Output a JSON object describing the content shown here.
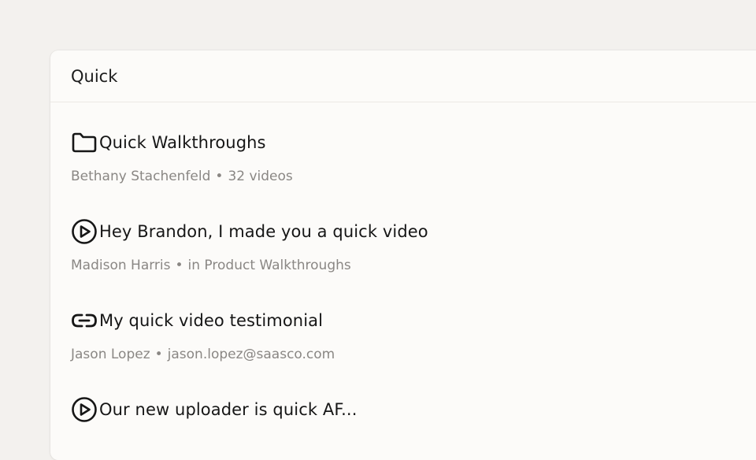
{
  "search": {
    "value": "Quick"
  },
  "results": [
    {
      "icon": "folder-icon",
      "title": "Quick Walkthroughs",
      "owner": "Bethany Stachenfeld",
      "detail": "32 videos"
    },
    {
      "icon": "play-icon",
      "title": "Hey Brandon, I made you a quick video",
      "owner": "Madison Harris",
      "detail": "in Product Walkthroughs"
    },
    {
      "icon": "link-icon",
      "title": "My quick video testimonial",
      "owner": "Jason Lopez",
      "detail": "jason.lopez@saasco.com"
    },
    {
      "icon": "play-icon",
      "title": "Our new uploader is quick AF...",
      "owner": "",
      "detail": ""
    }
  ],
  "separator": "•"
}
